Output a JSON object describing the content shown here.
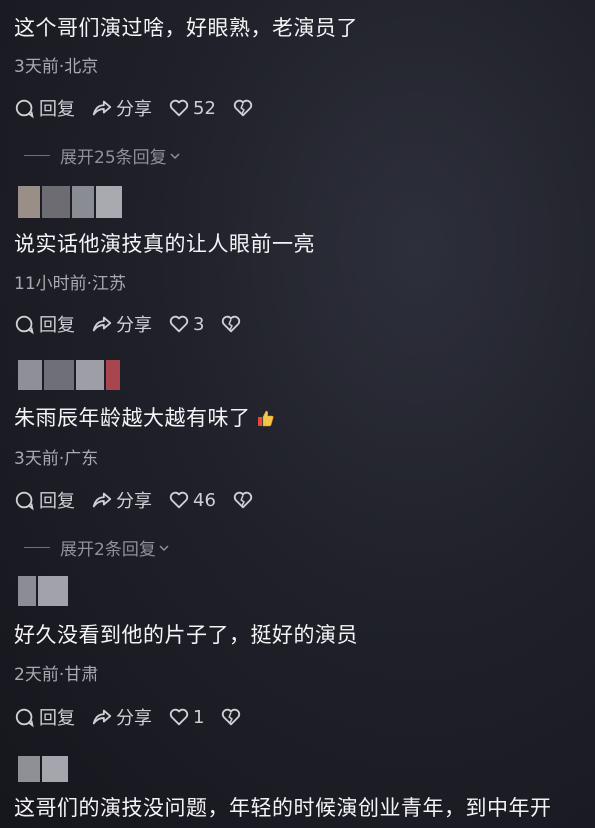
{
  "comments": [
    {
      "text": "这个哥们演过啥，好眼熟，老演员了",
      "meta": "3天前·北京",
      "reply_label": "回复",
      "share_label": "分享",
      "likes": "52",
      "expand_label": "展开25条回复"
    },
    {
      "text": "说实话他演技真的让人眼前一亮",
      "meta": "11小时前·江苏",
      "reply_label": "回复",
      "share_label": "分享",
      "likes": "3"
    },
    {
      "text": "朱雨辰年龄越大越有味了",
      "meta": "3天前·广东",
      "reply_label": "回复",
      "share_label": "分享",
      "likes": "46",
      "expand_label": "展开2条回复"
    },
    {
      "text": "好久没看到他的片子了，挺好的演员",
      "meta": "2天前·甘肃",
      "reply_label": "回复",
      "share_label": "分享",
      "likes": "1"
    },
    {
      "text": "这哥们的演技没问题，年轻的时候演创业青年，到中年开"
    }
  ],
  "icons": {
    "reply": "comment-bubble-icon",
    "share": "share-arrow-icon",
    "like": "heart-icon",
    "dislike": "broken-heart-icon",
    "thumbs": "thumbs-up-emoji"
  }
}
